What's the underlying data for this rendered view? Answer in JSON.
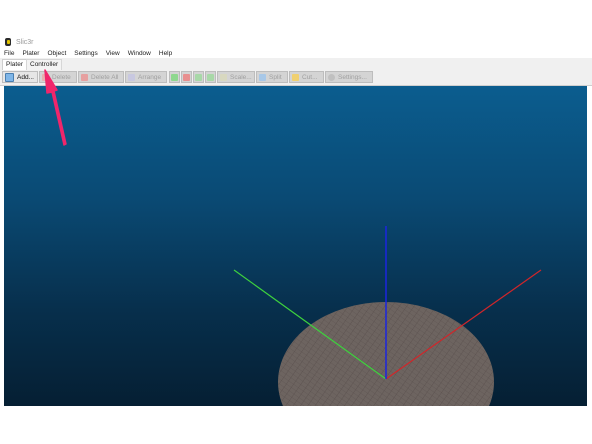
{
  "window": {
    "title": "Slic3r"
  },
  "menu": [
    "File",
    "Plater",
    "Object",
    "Settings",
    "View",
    "Window",
    "Help"
  ],
  "tabs": [
    {
      "label": "Plater",
      "active": true
    },
    {
      "label": "Controller",
      "active": false
    }
  ],
  "toolbar": {
    "add": "Add...",
    "delete": "Delete",
    "delete_all": "Delete All",
    "arrange": "Arrange",
    "scale": "Scale...",
    "split": "Split",
    "cut": "Cut...",
    "settings": "Settings..."
  },
  "icons": {
    "app": "slic3r-logo-icon",
    "add": "add-icon",
    "delete": "delete-icon",
    "delete_all": "delete-all-icon",
    "arrange": "arrange-icon",
    "increase": "plus-icon",
    "decrease": "minus-icon",
    "rotate_left": "rotate-left-icon",
    "rotate_right": "rotate-right-icon",
    "scale": "scale-icon",
    "split": "split-icon",
    "cut": "cut-icon",
    "settings": "settings-icon"
  },
  "colors": {
    "annotation_arrow": "#f0266b",
    "axis_x": "#d0262a",
    "axis_y": "#3ed23e",
    "axis_z": "#1b25e0",
    "bed": "#6d6460",
    "background_top": "#0b5d8f",
    "background_bottom": "#051f33"
  }
}
